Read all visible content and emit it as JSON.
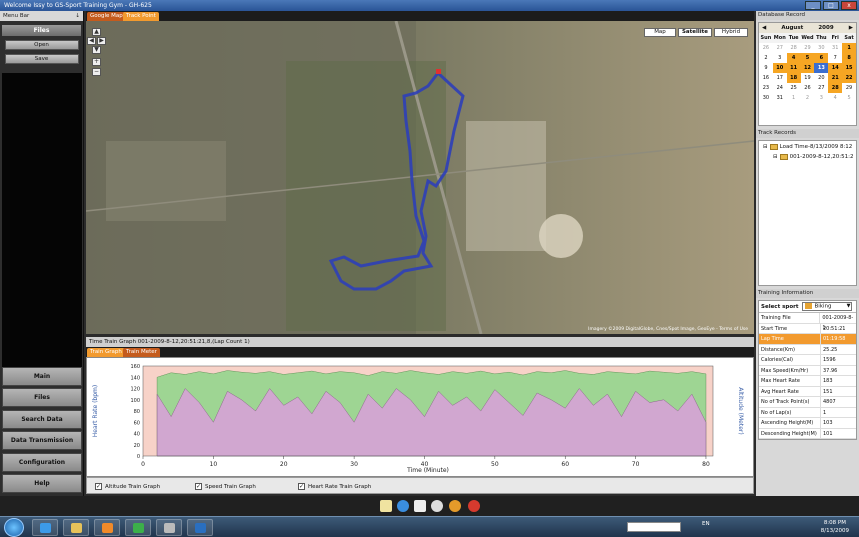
{
  "window": {
    "title": "Welcome Issy to GS-Sport Training Gym - GH-625"
  },
  "menu": {
    "bar_label": "Menu Bar",
    "pin": "↓",
    "files_header": "Files",
    "open_label": "Open",
    "save_label": "Save",
    "nav": [
      "Main",
      "Files",
      "Search Data",
      "Data Transmission",
      "Configuration",
      "Help"
    ]
  },
  "map": {
    "tabs": [
      "Google Map",
      "Track Point"
    ],
    "types": [
      "Map",
      "Satellite",
      "Hybrid"
    ],
    "selected_type": "Satellite",
    "copyright": "Imagery ©2009 DigitalGlobe, Cnes/Spot Image, GeoEye - Terms of Use"
  },
  "graph": {
    "title": "Time Train Graph 001-2009-8-12,20:51:21,8,(Lap Count 1)",
    "tabs": [
      "Train Graph",
      "Train Meter"
    ],
    "checks": [
      "Altitude Train Graph",
      "Speed Train Graph",
      "Heart Rate Train Graph"
    ]
  },
  "chart_data": {
    "type": "area",
    "xlabel": "Time (Minute)",
    "ylabel_left": "Heart Rate (bpm)",
    "ylabel_right": "Altitude (Meter)",
    "x_ticks": [
      0,
      10,
      20,
      30,
      40,
      50,
      60,
      70,
      80
    ],
    "y_left_ticks": [
      0,
      20,
      40,
      60,
      80,
      100,
      120,
      140,
      160
    ],
    "xlim": [
      0,
      81
    ],
    "ylim_left": [
      0,
      160
    ],
    "series": [
      {
        "name": "Altitude",
        "color": "#8fd68a",
        "x": [
          2,
          4,
          6,
          8,
          10,
          12,
          14,
          16,
          18,
          20,
          22,
          24,
          26,
          28,
          30,
          32,
          34,
          36,
          38,
          40,
          42,
          44,
          46,
          48,
          50,
          52,
          54,
          56,
          58,
          60,
          62,
          64,
          66,
          68,
          70,
          72,
          74,
          76,
          78,
          80
        ],
        "y": [
          140,
          148,
          145,
          150,
          146,
          152,
          149,
          147,
          150,
          145,
          148,
          151,
          146,
          150,
          148,
          143,
          150,
          147,
          152,
          148,
          145,
          150,
          147,
          151,
          146,
          149,
          144,
          150,
          148,
          152,
          147,
          145,
          150,
          148,
          146,
          151,
          149,
          147,
          150,
          146
        ]
      },
      {
        "name": "Speed",
        "color": "#d7a3d7",
        "x": [
          2,
          4,
          6,
          8,
          10,
          12,
          14,
          16,
          18,
          20,
          22,
          24,
          26,
          28,
          30,
          32,
          34,
          36,
          38,
          40,
          42,
          44,
          46,
          48,
          50,
          52,
          54,
          56,
          58,
          60,
          62,
          64,
          66,
          68,
          70,
          72,
          74,
          76,
          78,
          80
        ],
        "y": [
          110,
          70,
          120,
          95,
          60,
          115,
          100,
          80,
          120,
          90,
          105,
          75,
          115,
          95,
          60,
          110,
          85,
          120,
          100,
          70,
          115,
          90,
          105,
          80,
          118,
          95,
          72,
          112,
          100,
          85,
          120,
          90,
          110,
          70,
          115,
          95,
          100,
          80,
          110,
          60
        ]
      }
    ]
  },
  "right": {
    "db_label": "Database Record",
    "calendar": {
      "month": "August",
      "year": "2009",
      "prev": "◀",
      "next": "▶",
      "dows": [
        "Sun",
        "Mon",
        "Tue",
        "Wed",
        "Thu",
        "Fri",
        "Sat"
      ],
      "days": [
        "26",
        "27",
        "28",
        "29",
        "30",
        "31",
        "1",
        "2",
        "3",
        "4",
        "5",
        "6",
        "7",
        "8",
        "9",
        "10",
        "11",
        "12",
        "13",
        "14",
        "15",
        "16",
        "17",
        "18",
        "19",
        "20",
        "21",
        "22",
        "23",
        "24",
        "25",
        "26",
        "27",
        "28",
        "29",
        "30",
        "31",
        "1",
        "2",
        "3",
        "4",
        "5"
      ]
    },
    "track_label": "Track Records",
    "tree": [
      "Load Time-8/13/2009 8:12",
      "001-2009-8-12,20:51:2"
    ],
    "info_label": "Training Information",
    "select_sport_label": "Select sport",
    "sport": "Biking",
    "info_rows": [
      [
        "Training File",
        "001-2009-8-1"
      ],
      [
        "Start Time",
        "20:51:21"
      ],
      [
        "Lap Time",
        "01:19:58"
      ],
      [
        "Distance(Km)",
        "25.25"
      ],
      [
        "Calories(Cal)",
        "1596"
      ],
      [
        "Max Speed(Km/Hr)",
        "37.96"
      ],
      [
        "Max Heart Rate",
        "183"
      ],
      [
        "Avg Heart Rate",
        "151"
      ],
      [
        "No of Track Point(s)",
        "4807"
      ],
      [
        "No of Lap(s)",
        "1"
      ],
      [
        "Ascending Height(M)",
        "103"
      ],
      [
        "Descending Height(M)",
        "101"
      ]
    ]
  },
  "taskbar": {
    "lang": "EN",
    "time": "8:08 PM",
    "date": "8/13/2009"
  }
}
